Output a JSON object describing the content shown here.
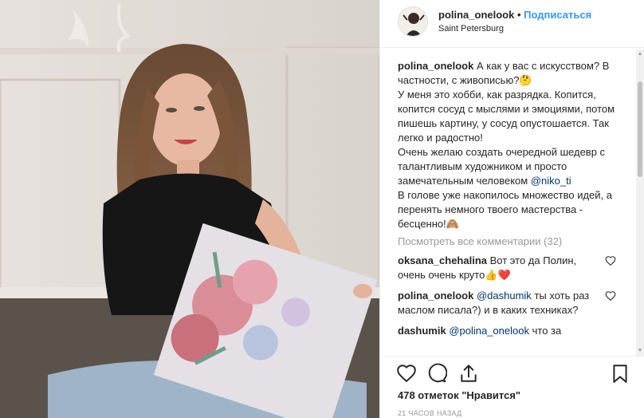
{
  "header": {
    "username": "polina_onelook",
    "separator": "•",
    "follow_label": "Подписаться",
    "location": "Saint Petersburg"
  },
  "caption": {
    "username": "polina_onelook",
    "line1": "А как у вас с искусством? В частности, с живописью?🤔",
    "line2": "У меня это хобби, как разрядка. Копится, копится сосуд с мыслями и эмоциями, потом пишешь картину, у сосуд опустошается. Так легко и радостно!",
    "line3_pre": "Очень желаю создать очередной шедевр с талантливым художником и просто замечательным человеком",
    "line3_mention": "@niko_ti",
    "line4": "В голове уже накопилось множество идей, а перенять немного твоего мастерства - бесценно!🙈"
  },
  "view_all_label": "Посмотреть все комментарии (32)",
  "comments": [
    {
      "username": "oksana_chehalina",
      "mention": "",
      "text": "Вот это да Полин, очень очень круто👍❤️"
    },
    {
      "username": "polina_onelook",
      "mention": "@dashumik",
      "text": "ты хоть раз маслом писала?) и в каких техниках?"
    },
    {
      "username": "dashumik",
      "mention": "@polina_onelook",
      "text": "что за"
    }
  ],
  "likes_label": "478 отметок \"Нравится\"",
  "timestamp": "21 ЧАСОВ НАЗАД",
  "icons": {
    "like": "heart-icon",
    "comment": "comment-icon",
    "share": "share-icon",
    "save": "bookmark-icon"
  },
  "colors": {
    "accent": "#3897f0",
    "mention": "#003569",
    "muted": "#999999"
  }
}
